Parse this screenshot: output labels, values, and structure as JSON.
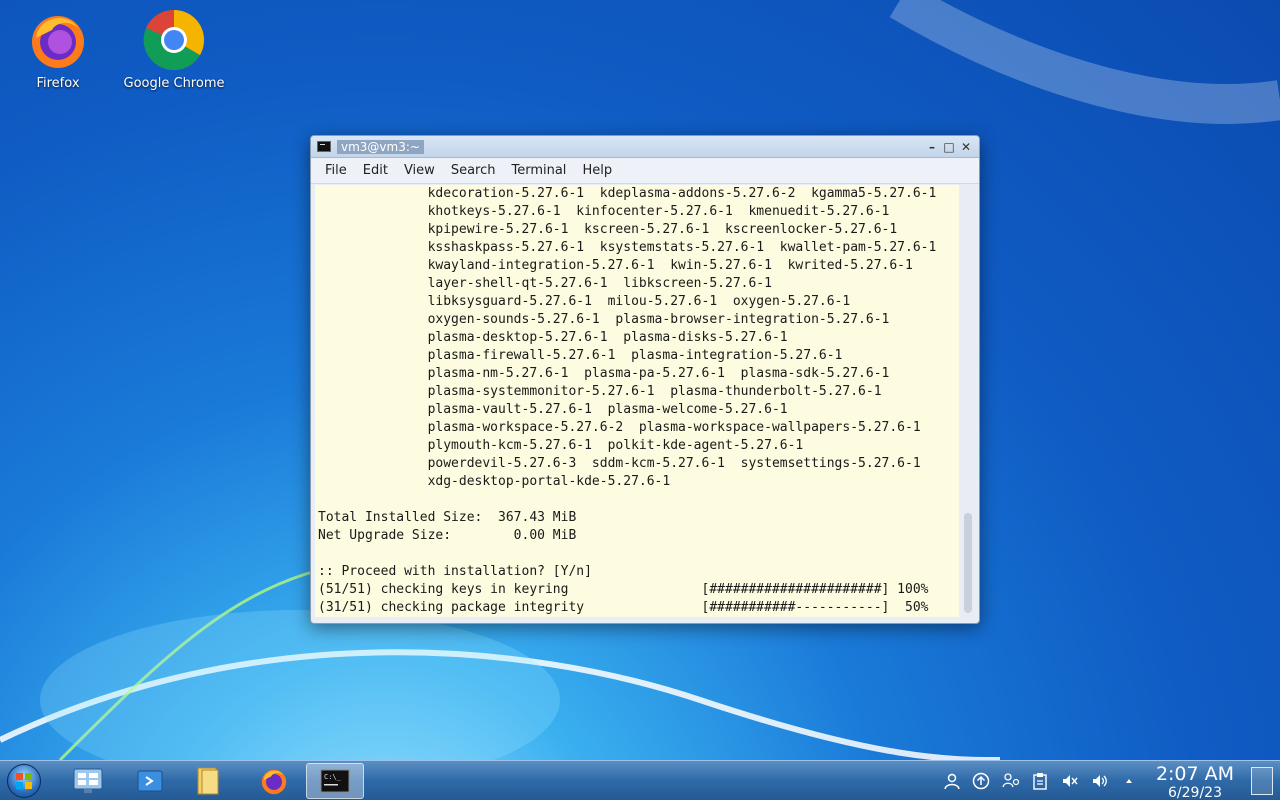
{
  "desktop": {
    "icons": [
      {
        "label": "Firefox"
      },
      {
        "label": "Google Chrome"
      }
    ]
  },
  "window": {
    "title": "vm3@vm3:~",
    "menu": [
      "File",
      "Edit",
      "View",
      "Search",
      "Terminal",
      "Help"
    ],
    "terminal_lines": [
      "              kdecoration-5.27.6-1  kdeplasma-addons-5.27.6-2  kgamma5-5.27.6-1",
      "              khotkeys-5.27.6-1  kinfocenter-5.27.6-1  kmenuedit-5.27.6-1",
      "              kpipewire-5.27.6-1  kscreen-5.27.6-1  kscreenlocker-5.27.6-1",
      "              ksshaskpass-5.27.6-1  ksystemstats-5.27.6-1  kwallet-pam-5.27.6-1",
      "              kwayland-integration-5.27.6-1  kwin-5.27.6-1  kwrited-5.27.6-1",
      "              layer-shell-qt-5.27.6-1  libkscreen-5.27.6-1",
      "              libksysguard-5.27.6-1  milou-5.27.6-1  oxygen-5.27.6-1",
      "              oxygen-sounds-5.27.6-1  plasma-browser-integration-5.27.6-1",
      "              plasma-desktop-5.27.6-1  plasma-disks-5.27.6-1",
      "              plasma-firewall-5.27.6-1  plasma-integration-5.27.6-1",
      "              plasma-nm-5.27.6-1  plasma-pa-5.27.6-1  plasma-sdk-5.27.6-1",
      "              plasma-systemmonitor-5.27.6-1  plasma-thunderbolt-5.27.6-1",
      "              plasma-vault-5.27.6-1  plasma-welcome-5.27.6-1",
      "              plasma-workspace-5.27.6-2  plasma-workspace-wallpapers-5.27.6-1",
      "              plymouth-kcm-5.27.6-1  polkit-kde-agent-5.27.6-1",
      "              powerdevil-5.27.6-3  sddm-kcm-5.27.6-1  systemsettings-5.27.6-1",
      "              xdg-desktop-portal-kde-5.27.6-1",
      "",
      "Total Installed Size:  367.43 MiB",
      "Net Upgrade Size:        0.00 MiB",
      "",
      ":: Proceed with installation? [Y/n]",
      "(51/51) checking keys in keyring                 [######################] 100%",
      "(31/51) checking package integrity               [###########-----------]  50%"
    ]
  },
  "taskbar": {
    "clock_time": "2:07 AM",
    "clock_date": "6/29/23"
  },
  "icons": {
    "start": "start-orb-icon",
    "tray": [
      "user-icon",
      "upload-icon",
      "network-icon",
      "clipboard-icon",
      "speaker-muted-icon",
      "speaker-icon",
      "tray-expand-icon"
    ]
  },
  "colors": {
    "terminal_bg": "#fdfbe0",
    "taskbar": "#2f6aa8"
  }
}
